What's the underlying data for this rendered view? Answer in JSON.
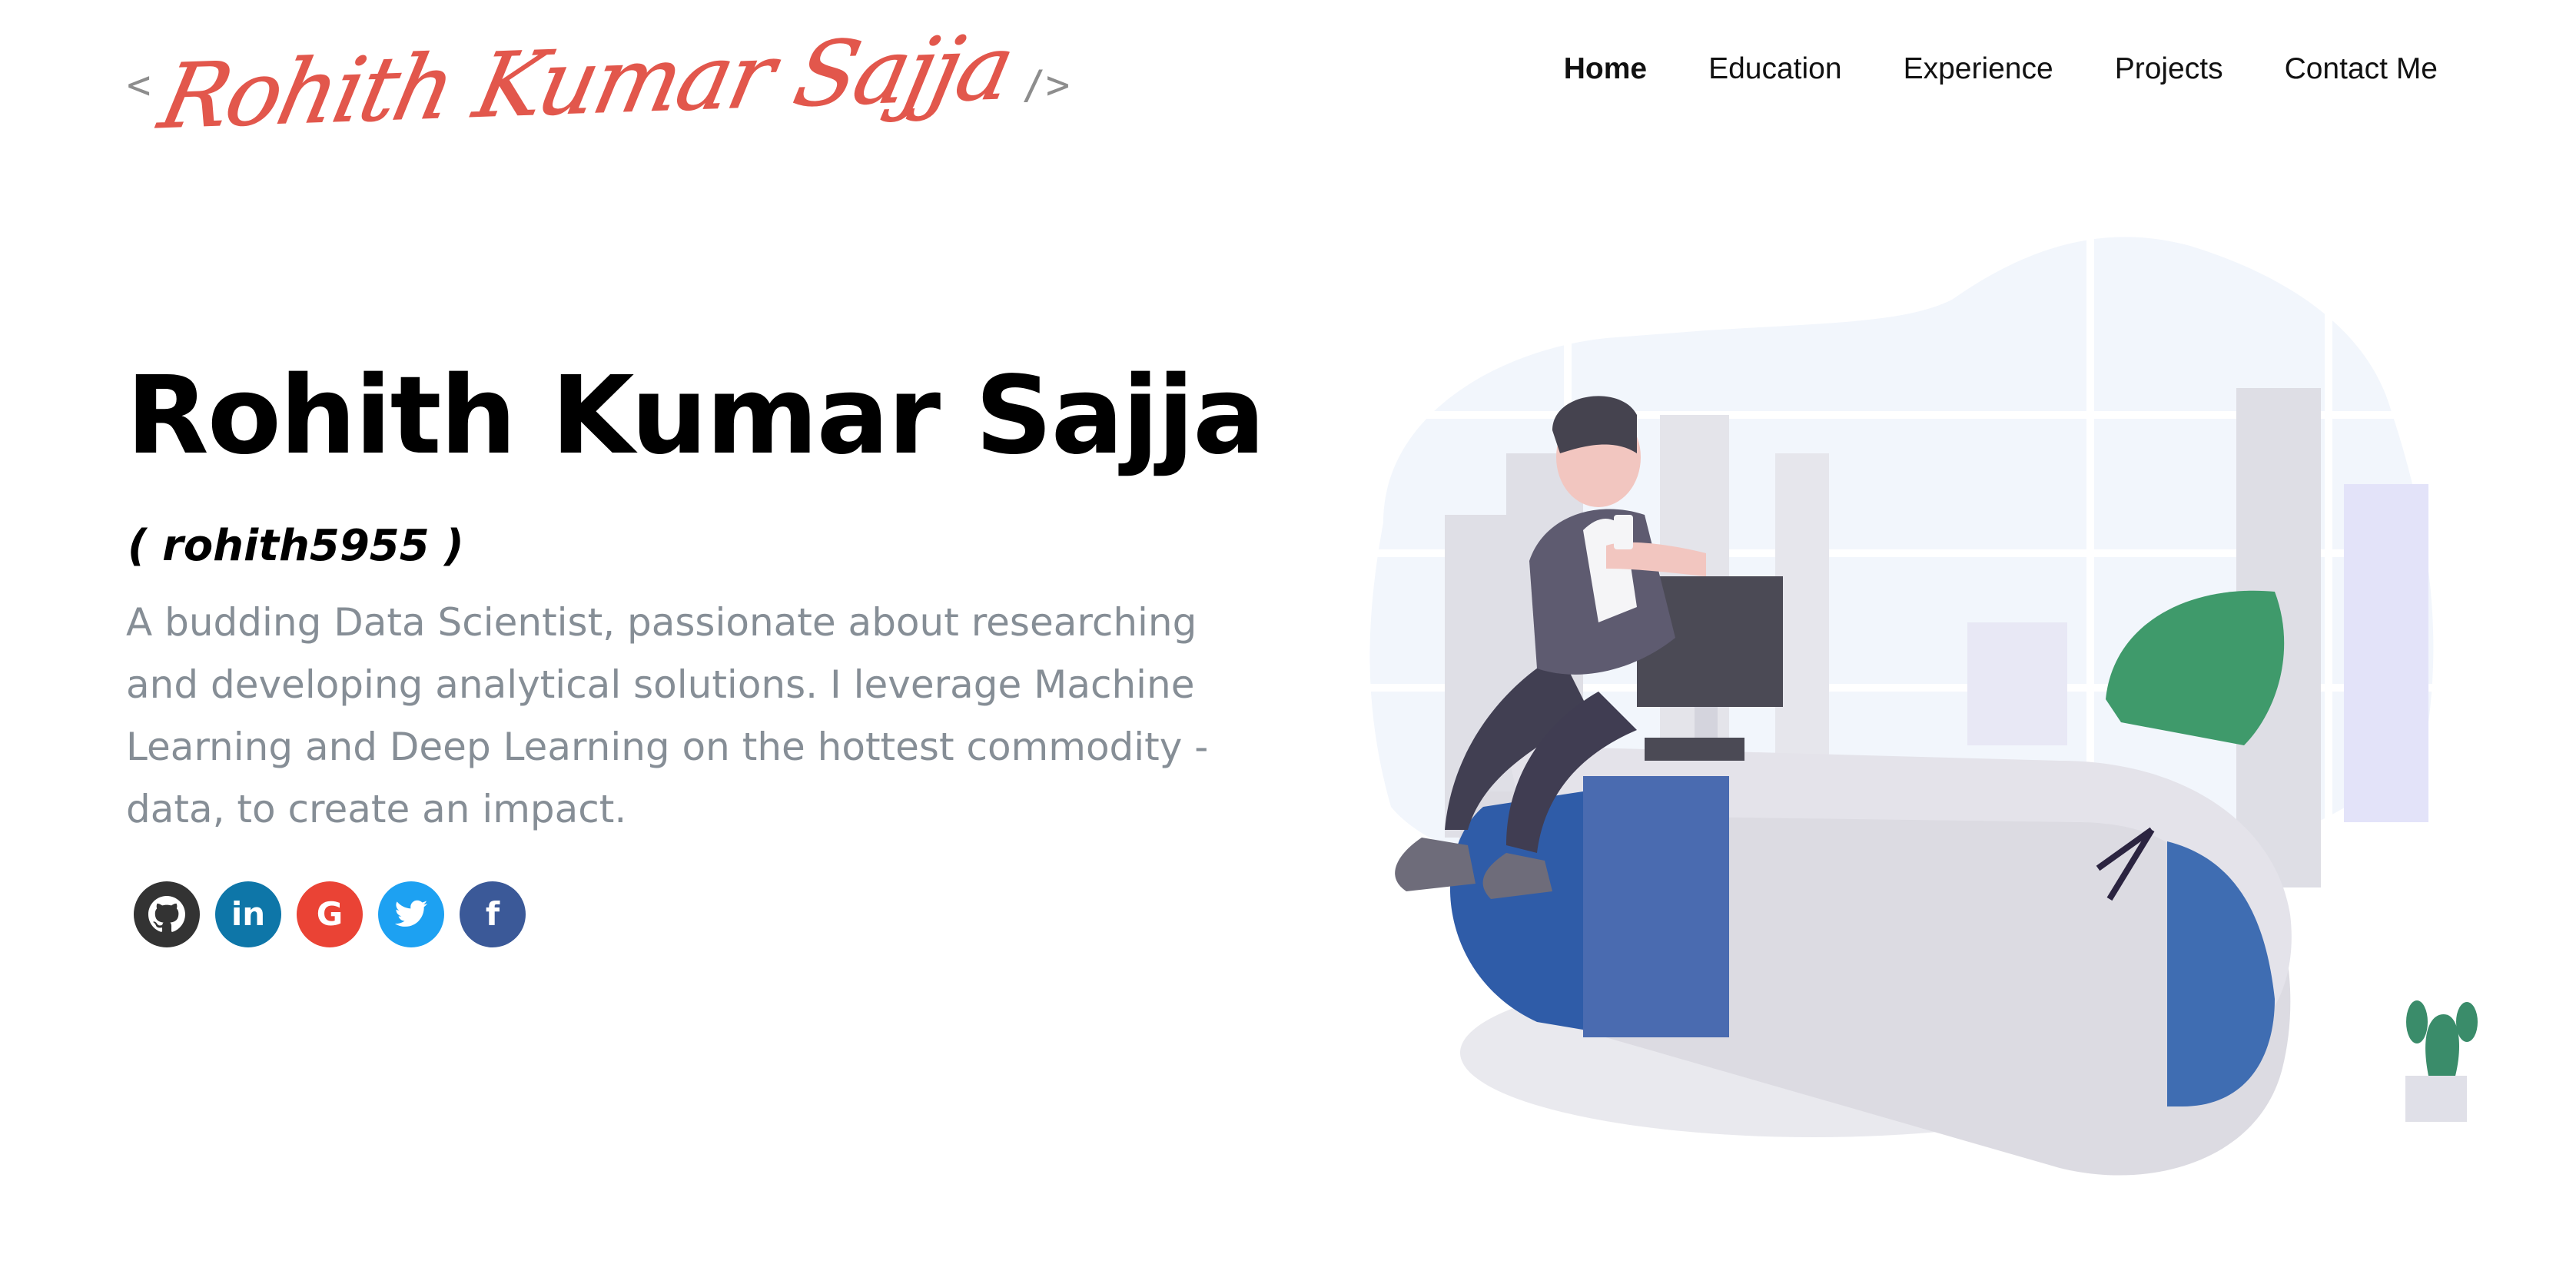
{
  "header": {
    "logo": {
      "open": "<",
      "name": "Rohith Kumar Sajja",
      "close": "/>"
    },
    "nav": [
      "Home",
      "Education",
      "Experience",
      "Projects",
      "Contact Me"
    ],
    "active_nav": "Home"
  },
  "hero": {
    "name": "Rohith Kumar Sajja",
    "handle": "( rohith5955 )",
    "bio": "A budding Data Scientist, passionate about researching and developing analytical solutions. I leverage Machine Learning and Deep Learning on the hottest commodity - data, to create an impact."
  },
  "social": [
    {
      "icon": "github-icon",
      "color": "#333333"
    },
    {
      "icon": "linkedin-icon",
      "color": "#0e76a8",
      "glyph": "in"
    },
    {
      "icon": "google-icon",
      "color": "#ea4335",
      "glyph": "G"
    },
    {
      "icon": "twitter-icon",
      "color": "#1da1f2"
    },
    {
      "icon": "facebook-icon",
      "color": "#3b5998",
      "glyph": "f"
    }
  ],
  "colors": {
    "logo": "#e2574c",
    "bio": "#868e96",
    "desk_blue": "#3f6db2",
    "chair_green": "#3f9a6b"
  }
}
